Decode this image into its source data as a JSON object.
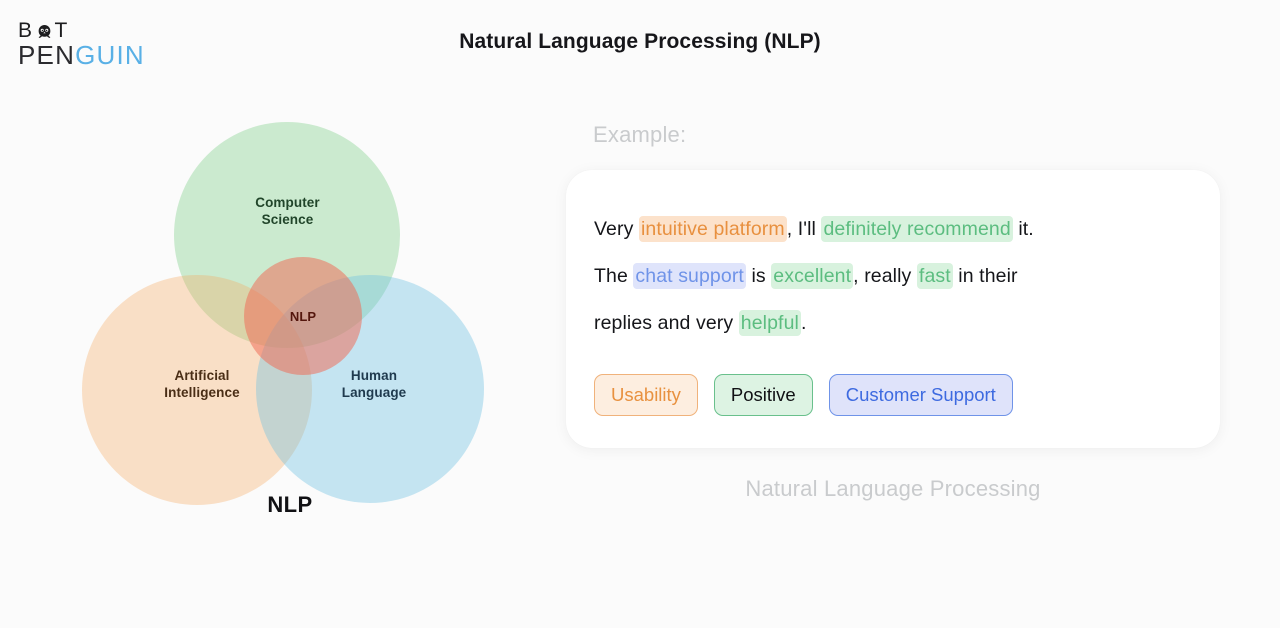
{
  "brand": {
    "line1_pre": "B",
    "line1_post": "T",
    "icon": "penguin-icon",
    "line2_dark": "PEN",
    "line2_accent": "GUIN",
    "accent_color": "#59b0e6"
  },
  "header": {
    "title": "Natural Language Processing (NLP)"
  },
  "venn": {
    "caption": "NLP",
    "circles": [
      {
        "id": "computer-science",
        "label": "Computer\nScience",
        "label_line1": "Computer",
        "label_line2": "Science",
        "color": "#7ecf88"
      },
      {
        "id": "artificial-intelligence",
        "label_line1": "Artificial",
        "label_line2": "Intelligence",
        "color": "#f6a75c"
      },
      {
        "id": "human-language",
        "label_line1": "Human",
        "label_line2": "Language",
        "color": "#6dc0e2"
      },
      {
        "id": "nlp-intersection",
        "label_line1": "NLP",
        "color": "#f06954"
      }
    ]
  },
  "example": {
    "label": "Example:",
    "caption": "Natural Language Processing",
    "sentence_segments": [
      {
        "text": "Very ",
        "highlight": "none"
      },
      {
        "text": "intuitive platform",
        "highlight": "orange"
      },
      {
        "text": ", I'll ",
        "highlight": "none"
      },
      {
        "text": "definitely recommend",
        "highlight": "green"
      },
      {
        "text": " it.",
        "highlight": "none"
      },
      {
        "text": "The ",
        "highlight": "none"
      },
      {
        "text": "chat support",
        "highlight": "blue"
      },
      {
        "text": " is ",
        "highlight": "none"
      },
      {
        "text": "excellent",
        "highlight": "green"
      },
      {
        "text": ", really ",
        "highlight": "none"
      },
      {
        "text": "fast",
        "highlight": "green"
      },
      {
        "text": " in their",
        "highlight": "none"
      },
      {
        "text": "replies and very ",
        "highlight": "none"
      },
      {
        "text": "helpful",
        "highlight": "green"
      },
      {
        "text": ".",
        "highlight": "none"
      }
    ],
    "line1": {
      "t1": "Very ",
      "h1": "intuitive platform",
      "t2": ", I'll ",
      "h2": "definitely recommend",
      "t3": " it."
    },
    "line2": {
      "t1": "The ",
      "h1": "chat support",
      "t2": " is ",
      "h2": "excellent",
      "t3": ", really ",
      "h3": "fast",
      "t4": " in their"
    },
    "line3": {
      "t1": "replies and very ",
      "h1": "helpful",
      "t2": "."
    },
    "tags": [
      {
        "label": "Usability",
        "style": "orange"
      },
      {
        "label": "Positive",
        "style": "green"
      },
      {
        "label": "Customer Support",
        "style": "blue"
      }
    ]
  }
}
